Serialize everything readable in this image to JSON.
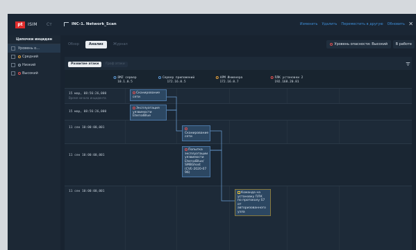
{
  "app": {
    "logo": "pt",
    "brand": "ISIM",
    "brand_tail": "Ст"
  },
  "sidebar": {
    "header": "Цепочки инциден",
    "items": [
      {
        "label": "Уровень о...",
        "dot": ""
      },
      {
        "label": "Средний",
        "dot": "orange"
      },
      {
        "label": "Низкий",
        "dot": "gray"
      },
      {
        "label": "Высокий",
        "dot": "red"
      }
    ]
  },
  "incident": {
    "title": "INC-1. Network_Scan",
    "actions": [
      "Изменить",
      "Удалить",
      "Переместить в другую",
      "Обновить"
    ],
    "close": "✕",
    "tabs": [
      "Обзор",
      "Анализ",
      "Журнал"
    ],
    "active_tab": "Анализ",
    "severity_label": "Уровень опасности: Высокий",
    "status_label": "В работе"
  },
  "analysis": {
    "subtabs": [
      "Развитие атаки",
      "Граф атаки"
    ],
    "active_subtab": "Развитие атаки",
    "filter_icon": "filter-icon",
    "hosts": [
      {
        "name": "DMZ сервер",
        "ip": "10.1.0.5",
        "dot": "blue"
      },
      {
        "name": "Сервер приложений",
        "ip": "172.16.0.5",
        "dot": "blue"
      },
      {
        "name": "АРМ Инженера",
        "ip": "172.16.0.7",
        "dot": "orange"
      },
      {
        "name": "ПЛК установки 2",
        "ip": "192.168.20.81",
        "dot": "red"
      }
    ],
    "rows": [
      {
        "time": "15 мар, 08:56:26,000",
        "sub": "Время начала инцидента"
      },
      {
        "time": "15 мар, 08:56:26,000",
        "sub": ""
      },
      {
        "time": "11 сен 10:00:00,001",
        "sub": ""
      },
      {
        "time": "11 сен 10:00:00,001",
        "sub": ""
      },
      {
        "time": "11 сен 10:00:00,001",
        "sub": ""
      }
    ],
    "nodes": [
      {
        "text": "Сканирование\nсети",
        "dot": "red"
      },
      {
        "text": "Эксплуатация\nуязвимости\nEternalBlue",
        "dot": "red"
      },
      {
        "text": "Сканирование\nсети",
        "dot": "red"
      },
      {
        "text": "Попытка\nэксплуатации\nуязвимости\nEternalBlue/\nSMBGhost\n(CVE-2020-07\n96)",
        "dot": "red"
      },
      {
        "text": "Команда на\nустановку ПЛК\nпо протоколу S7\nот\nавторизованного\nузла",
        "dot": "yellow"
      }
    ]
  }
}
